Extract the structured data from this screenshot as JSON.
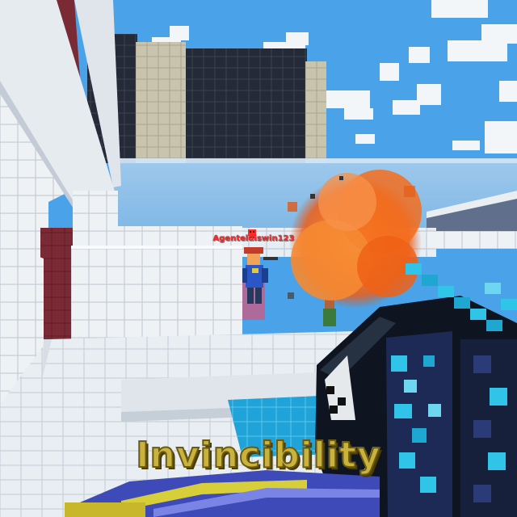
{
  "hud": {
    "enemy_nametag": "Agenteluiswin123",
    "powerup_banner": "Invincibility"
  },
  "colors": {
    "sky": "#4aa3e8",
    "nametag": "#ff2a2a",
    "banner_text": "#c9b33c",
    "explosion": "#f26a1b",
    "weapon_accent": "#2fc4e8",
    "water": "#1fa3d8"
  },
  "icons": {
    "enemy_marker": "skull-icon"
  }
}
